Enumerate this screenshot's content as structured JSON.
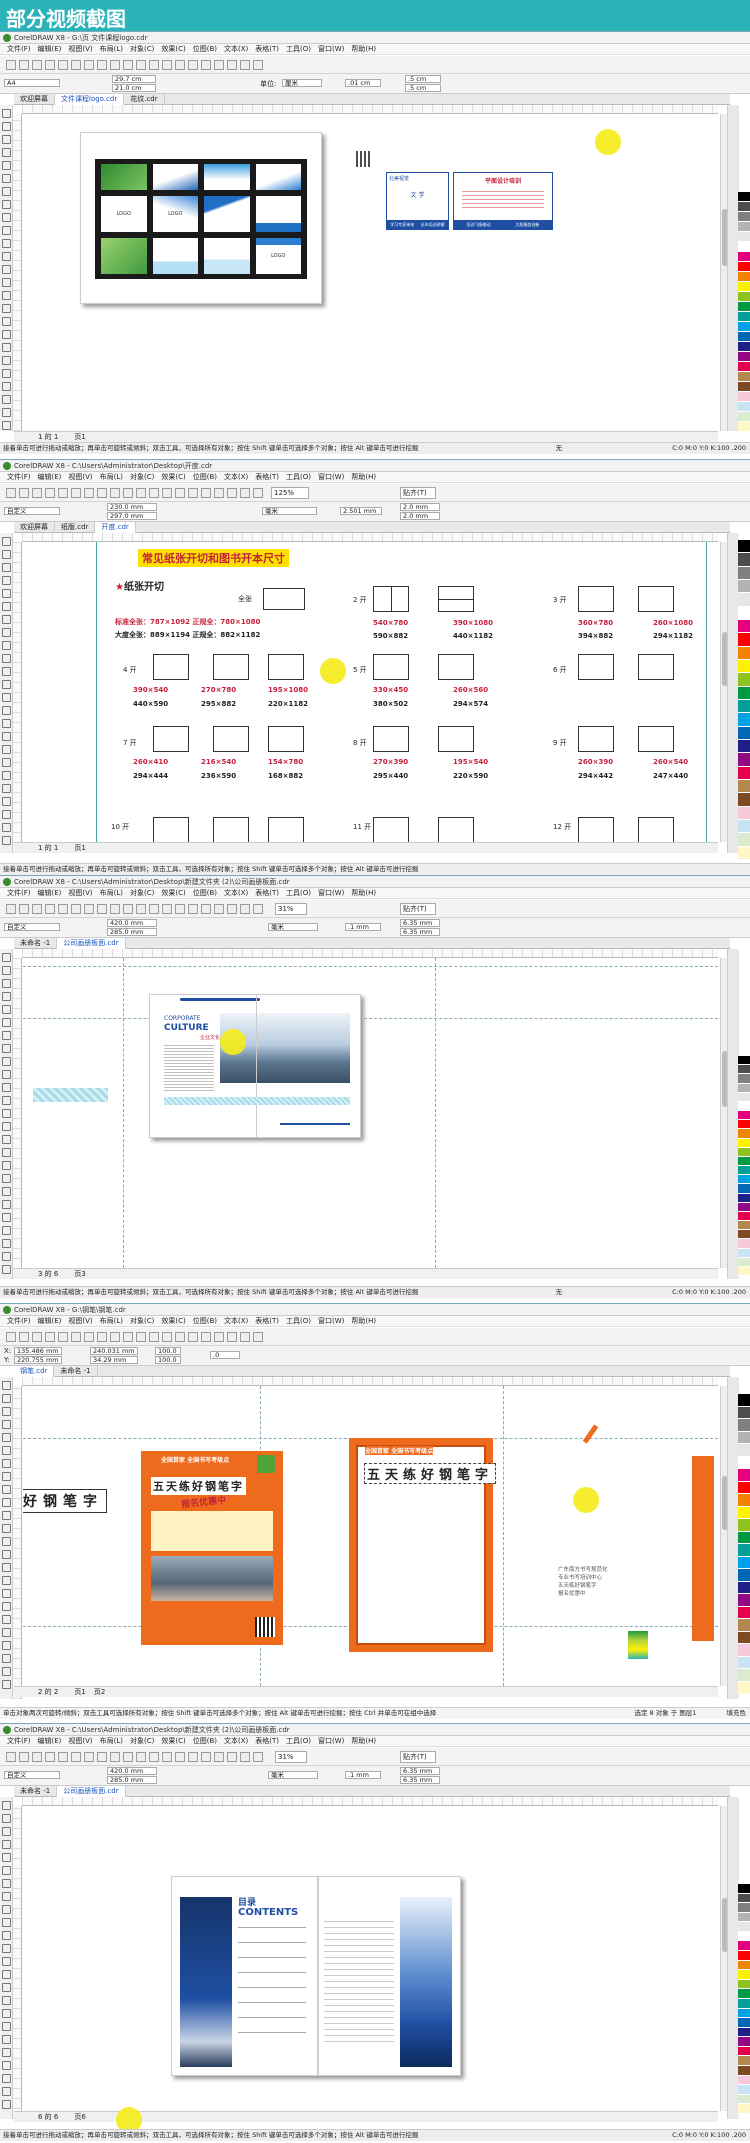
{
  "header_title": "部分视频截图",
  "menu_items": [
    "文件(F)",
    "编辑(E)",
    "视图(V)",
    "布局(L)",
    "对象(C)",
    "效果(C)",
    "位图(B)",
    "文本(X)",
    "表格(T)",
    "工具(O)",
    "窗口(W)",
    "帮助(H)"
  ],
  "colors": {
    "header": "#2bb3ba",
    "cursor": "#f4ec1c",
    "palette": [
      "#000000",
      "#4d4d4d",
      "#808080",
      "#b3b3b3",
      "#e6e6e6",
      "#ffffff",
      "#e4007f",
      "#ff0000",
      "#f08300",
      "#fff100",
      "#8fc31f",
      "#009944",
      "#009e96",
      "#00a0e9",
      "#0068b7",
      "#1d2088",
      "#920783",
      "#e5004f",
      "#b28850",
      "#7d4a21",
      "#f7c8d9",
      "#c9e3f5",
      "#d9ecd0",
      "#fff8c4"
    ]
  },
  "shot1": {
    "window_title": "CorelDRAW X8 - G:\\页 文件课程logo.cdr",
    "preset": "A4",
    "width": "29.7 cm",
    "height": "21.0 cm",
    "unit_label": "单位:",
    "unit": "厘米",
    "nudge": ".01 cm",
    "dup_x": ".5 cm",
    "dup_y": ".5 cm",
    "tabs": [
      "欢迎屏幕",
      "文件课程logo.cdr",
      "花纹.cdr"
    ],
    "page_label": "1 的 1",
    "page_name": "页1",
    "status": "接着单击可进行拖动或缩放；再单击可旋转或倾斜；双击工具，可选择所有对象；按住 Shift 键单击可选择多个对象；按住 Alt 键单击可进行挖掘",
    "status_fill": "无",
    "status_outline": "C:0 M:0 Y:0 K:100  .200",
    "card_logo": "LOGO",
    "bc1_name": "文 学",
    "bc1_company": "北美视觉",
    "bc1_footer": [
      "学习专家带来",
      "长年培训讲解"
    ],
    "bc2_title": "平面设计培训",
    "bc2_footer": [
      "培训飞扬推动",
      "大胆服务创新"
    ]
  },
  "shot2": {
    "window_title": "CorelDRAW X8 - C:\\Users\\Administrator\\Desktop\\开度.cdr",
    "preset": "自定义",
    "width": "230.0 mm",
    "height": "297.0 mm",
    "unit": "毫米",
    "nudge": "2.501 mm",
    "dup_x": "2.0 mm",
    "dup_y": "2.0 mm",
    "zoom": "125%",
    "snap": "贴齐(T)",
    "tabs": [
      "欢迎屏幕",
      "纸版.cdr",
      "开度.cdr"
    ],
    "doc_title": "常见纸张开切和图书开本尺寸",
    "section": "纸张开切",
    "labels": {
      "full": "全张",
      "k2": "2 开",
      "k3": "3 开",
      "k4": "4 开",
      "k5": "5 开",
      "k6": "6 开",
      "k7": "7 开",
      "k8": "8 开",
      "k9": "9 开",
      "k10": "10 开",
      "k11": "11 开",
      "k12": "12 开"
    },
    "full_std": "标准全张：787×1092  正规全：780×1080",
    "full_big": "大度全张：889×1194  正规全：882×1182",
    "sizes": {
      "k2a": "540×780",
      "k2b": "390×1080",
      "k2c": "590×882",
      "k2d": "440×1182",
      "k3a": "360×780",
      "k3b": "260×1080",
      "k3c": "394×882",
      "k3d": "294×1182",
      "k4a": "390×540",
      "k4b": "270×780",
      "k4c": "195×1080",
      "k4d": "440×590",
      "k4e": "295×882",
      "k4f": "220×1182",
      "k5a": "330×450",
      "k5b": "260×560",
      "k5c": "380×502",
      "k5d": "294×574",
      "k7a": "260×410",
      "k7b": "216×540",
      "k7c": "154×780",
      "k7d": "294×444",
      "k7e": "236×590",
      "k7f": "168×882",
      "k8a": "270×390",
      "k8b": "195×540",
      "k8c": "295×440",
      "k8d": "220×590",
      "k9a": "260×390",
      "k9b": "260×540",
      "k9c": "294×442",
      "k9d": "247×440"
    },
    "page_label": "1 的 1",
    "page_name": "页1",
    "status": "接着单击可进行拖动或缩放；再单击可旋转或倾斜；双击工具，可选择所有对象；按住 Shift 键单击可选择多个对象；按住 Alt 键单击可进行挖掘"
  },
  "shot3": {
    "window_title": "CorelDRAW X8 - C:\\Users\\Administrator\\Desktop\\新建文件夹 (2)\\公司画册板面.cdr",
    "preset": "自定义",
    "width": "420.0 mm",
    "height": "285.0 mm",
    "unit": "毫米",
    "nudge": ".1 mm",
    "dup_x": "6.35 mm",
    "dup_y": "6.35 mm",
    "zoom": "31%",
    "snap": "贴齐(T)",
    "tabs": [
      "未命名 -1",
      "公司画册板面.cdr"
    ],
    "corp1": "CORPORATE",
    "corp2": "CULTURE",
    "corp3": "企业文化",
    "page_label": "3 的 6",
    "page_name": "页3",
    "status": "接着单击可进行拖动或缩放；再单击可旋转或倾斜；双击工具，可选择所有对象；按住 Shift 键单击可选择多个对象；按住 Alt 键单击可进行挖掘",
    "status_fill": "无",
    "status_outline": "C:0 M:0 Y:0 K:100  .200"
  },
  "shot4": {
    "window_title": "CorelDRAW X8 - G:\\钢笔\\钢笔.cdr",
    "x": "135.486 mm",
    "y": "220.755 mm",
    "w": "240.031 mm",
    "h": "34.29 mm",
    "sx": "100.0",
    "sy": "100.0",
    "angle": ".0",
    "tabs": [
      "钢笔.cdr",
      "未命名 -1"
    ],
    "headline": "五天练好钢笔字",
    "left_text": "好钢笔字",
    "poster_top": "全国首家 全国书写考级点",
    "poster_sub": "报名优惠中",
    "side_text": [
      "广东南方书写规范化",
      "专业书写培训中心",
      "五天练好钢笔字",
      "报名优惠中"
    ],
    "page_label": "2 的 2",
    "page_names": [
      "页1",
      "页2"
    ],
    "status": "单击对象两次可旋转/倾斜；双击工具可选择所有对象；按住 Shift 键单击可选择多个对象；按住 Alt 键单击可进行挖掘；按住 Ctrl 并单击可在组中选择",
    "status_right": "选定 8 对象 于 图层1",
    "status_fill": "填充色"
  },
  "shot5": {
    "window_title": "CorelDRAW X8 - C:\\Users\\Administrator\\Desktop\\新建文件夹 (2)\\公司画册板面.cdr",
    "preset": "自定义",
    "width": "420.0 mm",
    "height": "285.0 mm",
    "unit": "毫米",
    "nudge": ".1 mm",
    "dup_x": "6.35 mm",
    "dup_y": "6.35 mm",
    "zoom": "31%",
    "snap": "贴齐(T)",
    "tabs": [
      "未命名 -1",
      "公司画册板面.cdr"
    ],
    "toc1": "目录",
    "toc2": "CONTENTS",
    "page_label": "6 的 6",
    "page_name": "页6",
    "status": "接着单击可进行拖动或缩放；再单击可旋转或倾斜；双击工具，可选择所有对象；按住 Shift 键单击可选择多个对象；按住 Alt 键单击可进行挖掘",
    "status_outline": "C:0 M:0 Y:0 K:100  .200"
  }
}
